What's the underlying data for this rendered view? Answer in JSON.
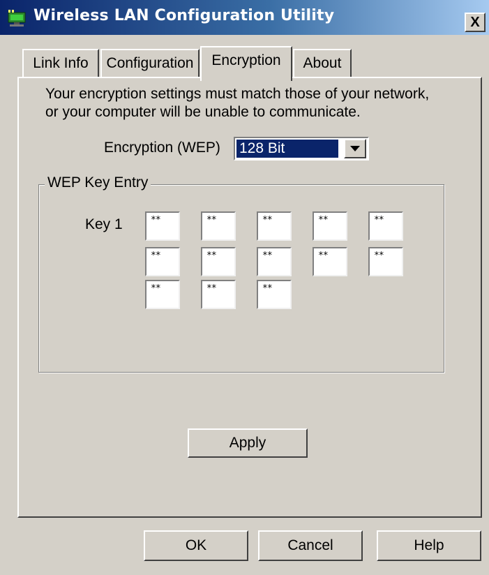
{
  "window": {
    "title": "Wireless LAN Configuration Utility",
    "close_label": "X"
  },
  "tabs": [
    {
      "label": "Link Info",
      "active": false
    },
    {
      "label": "Configuration",
      "active": false
    },
    {
      "label": "Encryption",
      "active": true
    },
    {
      "label": "About",
      "active": false
    }
  ],
  "encryption": {
    "description_line1": "Your encryption settings must match those of your network,",
    "description_line2": "or your computer will be unable to communicate.",
    "wep_label": "Encryption (WEP)",
    "wep_value": "128 Bit",
    "group_title": "WEP Key Entry",
    "key_label": "Key 1",
    "key_fields": [
      "**",
      "**",
      "**",
      "**",
      "**",
      "**",
      "**",
      "**",
      "**",
      "**",
      "**",
      "**",
      "**"
    ],
    "apply_label": "Apply"
  },
  "buttons": {
    "ok": "OK",
    "cancel": "Cancel",
    "help": "Help"
  },
  "colors": {
    "titlebar_start": "#0a246a",
    "titlebar_end": "#a6caf0",
    "face": "#d4d0c8",
    "selection": "#0a246a"
  },
  "icons": {
    "app": "network-adapter-icon",
    "dropdown": "chevron-down-icon"
  }
}
